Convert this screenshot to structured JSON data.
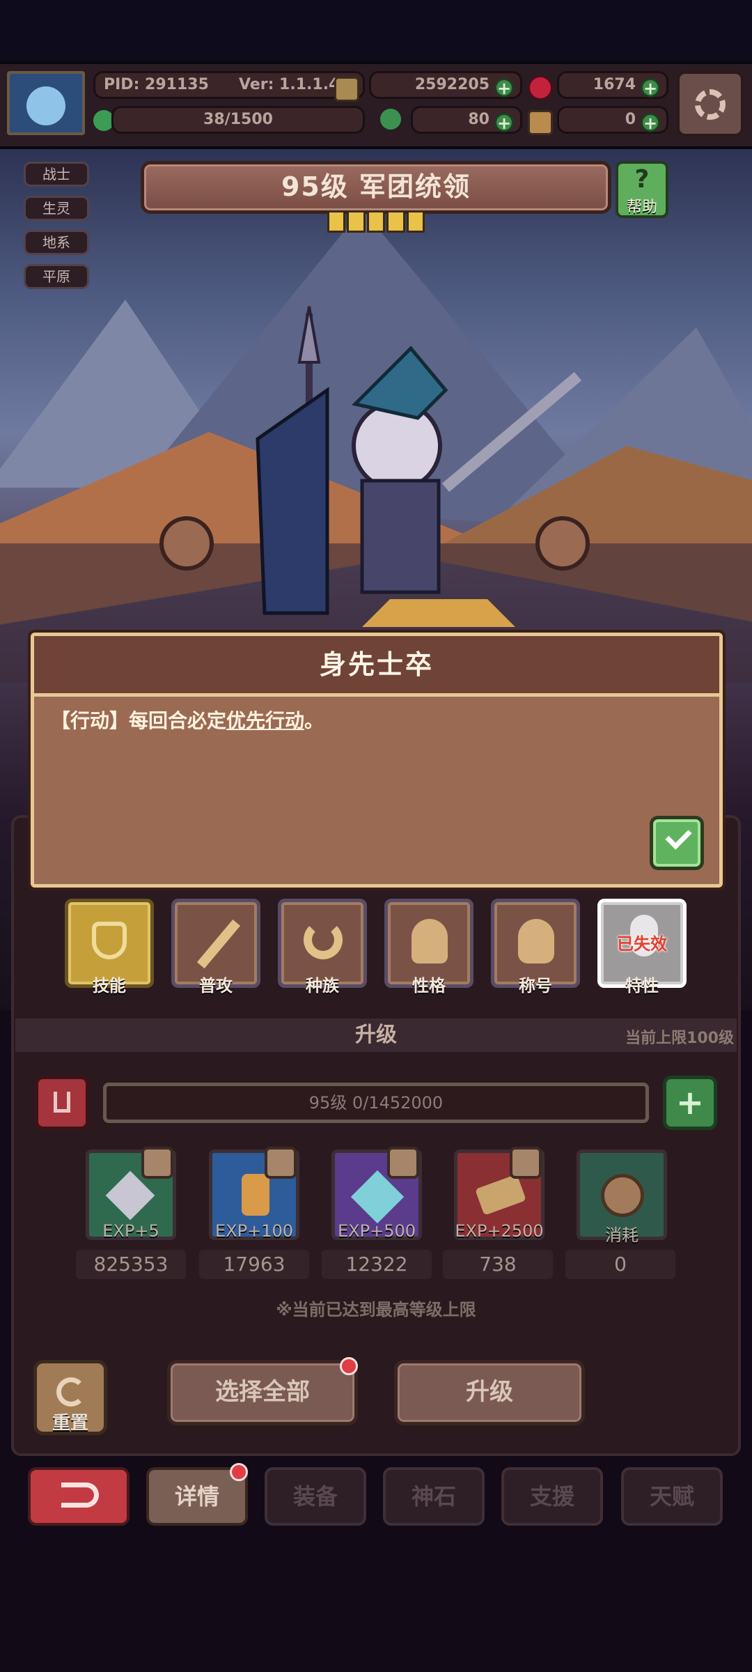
{
  "status_bar": {
    "pid": "PID: 291135",
    "version": "Ver: 1.1.1.4",
    "gold": "2592205",
    "gems": "1674",
    "stamina": "38/1500",
    "clover": "80",
    "other_currency": "0"
  },
  "hero": {
    "tags": [
      "战士",
      "生灵",
      "地系",
      "平原"
    ],
    "title": "95级  军团统领",
    "stars": 5,
    "help_label": "帮助"
  },
  "dialog": {
    "title": "身先士卒",
    "body_prefix": "【行动】每回合必定",
    "body_link": "优先行动",
    "body_suffix": "。"
  },
  "tabs": [
    {
      "label": "技能"
    },
    {
      "label": "普攻"
    },
    {
      "label": "种族"
    },
    {
      "label": "性格"
    },
    {
      "label": "称号"
    },
    {
      "label": "特性",
      "badge": "已失效"
    }
  ],
  "upgrade": {
    "header": "升级",
    "cap": "当前上限100级",
    "level_exp": "95级  0/1452000",
    "items": [
      {
        "exp": "EXP+5",
        "count": "825353",
        "color": "#2f6a4f"
      },
      {
        "exp": "EXP+100",
        "count": "17963",
        "color": "#2e5c9a"
      },
      {
        "exp": "EXP+500",
        "count": "12322",
        "color": "#5b3c8c"
      },
      {
        "exp": "EXP+2500",
        "count": "738",
        "color": "#8a2f32"
      },
      {
        "exp": "消耗",
        "count": "0",
        "color": "#2f5a4b"
      }
    ],
    "max_note": "※当前已达到最高等级上限"
  },
  "actions": {
    "reset": "重置",
    "select_all": "选择全部",
    "upgrade": "升级"
  },
  "nav": {
    "back": "",
    "items": [
      "详情",
      "装备",
      "神石",
      "支援",
      "天赋"
    ]
  }
}
